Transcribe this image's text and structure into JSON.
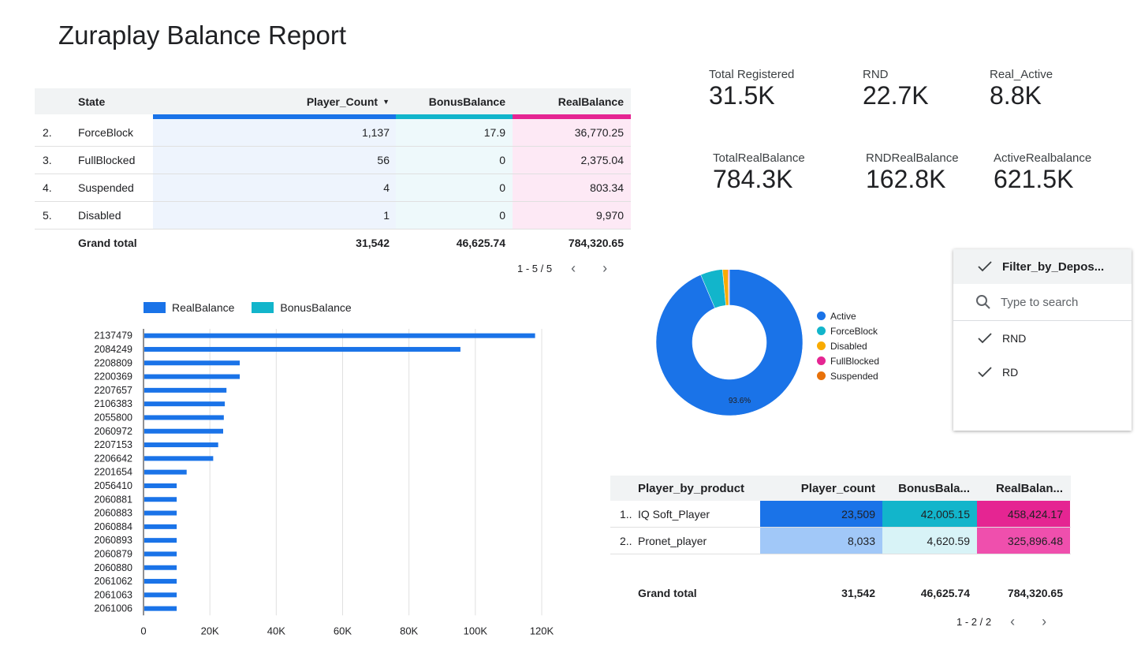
{
  "title": "Zuraplay Balance Report",
  "state_table": {
    "headers": {
      "state": "State",
      "player_count": "Player_Count",
      "sort_icon": "▼",
      "bonus": "BonusBalance",
      "real": "RealBalance"
    },
    "rows": [
      {
        "idx": "2.",
        "state": "ForceBlock",
        "player_count": "1,137",
        "bonus": "17.9",
        "real": "36,770.25"
      },
      {
        "idx": "3.",
        "state": "FullBlocked",
        "player_count": "56",
        "bonus": "0",
        "real": "2,375.04"
      },
      {
        "idx": "4.",
        "state": "Suspended",
        "player_count": "4",
        "bonus": "0",
        "real": "803.34"
      },
      {
        "idx": "5.",
        "state": "Disabled",
        "player_count": "1",
        "bonus": "0",
        "real": "9,970"
      }
    ],
    "total": {
      "label": "Grand total",
      "player_count": "31,542",
      "bonus": "46,625.74",
      "real": "784,320.65"
    },
    "pager": "1 - 5 / 5"
  },
  "kpis": [
    {
      "label": "Total Registered",
      "value": "31.5K"
    },
    {
      "label": "RND",
      "value": "22.7K"
    },
    {
      "label": "Real_Active",
      "value": "8.8K"
    },
    {
      "label": "TotalRealBalance",
      "value": "784.3K"
    },
    {
      "label": "RNDRealBalance",
      "value": "162.8K"
    },
    {
      "label": "ActiveRealbalance",
      "value": "621.5K"
    }
  ],
  "colors": {
    "blue": "#1a73e8",
    "teal": "#12b5cb",
    "pink": "#e52592",
    "orange": "#e8710a",
    "amber": "#f9ab00"
  },
  "chart_data": [
    {
      "type": "bar",
      "orientation": "horizontal",
      "categories": [
        "2137479",
        "2084249",
        "2208809",
        "2200369",
        "2207657",
        "2106383",
        "2055800",
        "2060972",
        "2207153",
        "2206642",
        "2201654",
        "2056410",
        "2060881",
        "2060883",
        "2060884",
        "2060893",
        "2060879",
        "2060880",
        "2061062",
        "2061063",
        "2061006"
      ],
      "series": [
        {
          "name": "RealBalance",
          "values": [
            118000,
            95500,
            29000,
            29000,
            25000,
            24500,
            24200,
            24000,
            22500,
            21000,
            13000,
            10000,
            10000,
            10000,
            10000,
            10000,
            10000,
            10000,
            10000,
            10000,
            10000
          ]
        },
        {
          "name": "BonusBalance",
          "values": [
            0,
            0,
            0,
            0,
            0,
            0,
            0,
            0,
            0,
            0,
            0,
            0,
            0,
            0,
            0,
            0,
            0,
            0,
            0,
            0,
            0
          ]
        }
      ],
      "xticks": [
        "0",
        "20K",
        "40K",
        "60K",
        "80K",
        "100K",
        "120K"
      ],
      "xlim": [
        0,
        120000
      ],
      "legend": "top",
      "grid": true
    },
    {
      "type": "pie",
      "donut": true,
      "labels": [
        "Active",
        "ForceBlock",
        "Disabled",
        "FullBlocked",
        "Suspended"
      ],
      "values": [
        93.6,
        4.9,
        1.2,
        0.2,
        0.1
      ],
      "data_label": "93.6%",
      "legend": "right"
    }
  ],
  "filter": {
    "title": "Filter_by_Depos...",
    "search_placeholder": "Type to search",
    "options": [
      {
        "label": "RND",
        "checked": true
      },
      {
        "label": "RD",
        "checked": true
      }
    ]
  },
  "product_table": {
    "headers": {
      "product": "Player_by_product",
      "player_count": "Player_count",
      "bonus": "BonusBala...",
      "real": "RealBalan..."
    },
    "rows": [
      {
        "idx": "1..",
        "product": "IQ Soft_Player",
        "player_count": "23,509",
        "bonus": "42,005.15",
        "real": "458,424.17"
      },
      {
        "idx": "2..",
        "product": "Pronet_player",
        "player_count": "8,033",
        "bonus": "4,620.59",
        "real": "325,896.48"
      }
    ],
    "total": {
      "label": "Grand total",
      "player_count": "31,542",
      "bonus": "46,625.74",
      "real": "784,320.65"
    },
    "pager": "1 - 2 / 2"
  }
}
